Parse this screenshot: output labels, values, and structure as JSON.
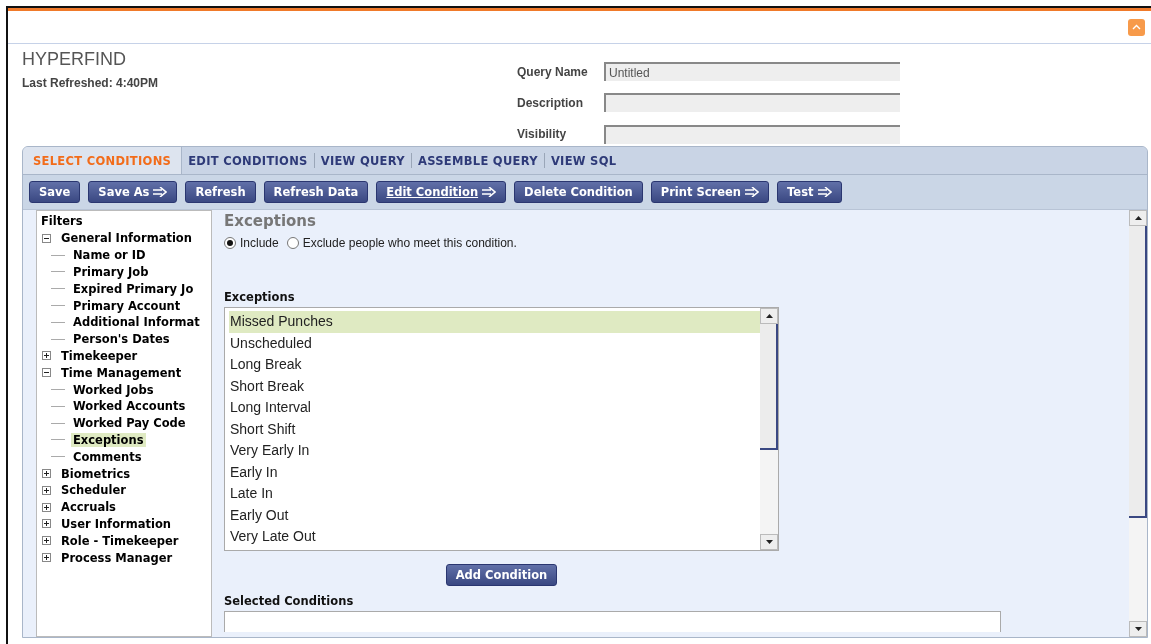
{
  "header": {
    "title": "HYPERFIND",
    "last_refreshed": "Last Refreshed: 4:40PM"
  },
  "query_form": [
    {
      "label": "Query Name",
      "value": "Untitled"
    },
    {
      "label": "Description"
    },
    {
      "label": "Visibility"
    }
  ],
  "tabs": [
    {
      "label": "SELECT CONDITIONS",
      "selected": true
    },
    {
      "label": "EDIT CONDITIONS",
      "selected": false
    },
    {
      "label": "VIEW QUERY",
      "selected": false
    },
    {
      "label": "ASSEMBLE QUERY",
      "selected": false
    },
    {
      "label": "VIEW SQL",
      "selected": false
    }
  ],
  "toolbar": [
    {
      "label": "Save",
      "arrow": false,
      "underlined": false
    },
    {
      "label": "Save As",
      "arrow": true,
      "underlined": false
    },
    {
      "label": "Refresh",
      "arrow": false,
      "underlined": false
    },
    {
      "label": "Refresh Data",
      "arrow": false,
      "underlined": false
    },
    {
      "label": "Edit Condition",
      "arrow": true,
      "underlined": true
    },
    {
      "label": "Delete Condition",
      "arrow": false,
      "underlined": false
    },
    {
      "label": "Print Screen",
      "arrow": true,
      "underlined": false
    },
    {
      "label": "Test",
      "arrow": true,
      "underlined": false
    }
  ],
  "filters": {
    "title": "Filters",
    "items": [
      {
        "label": "General Information",
        "expanded": true,
        "children": [
          {
            "label": "Name or ID",
            "selected": false
          },
          {
            "label": "Primary Job",
            "selected": false
          },
          {
            "label": "Expired Primary Jo",
            "selected": false
          },
          {
            "label": "Primary Account",
            "selected": false
          },
          {
            "label": "Additional Informat",
            "selected": false
          },
          {
            "label": "Person's Dates",
            "selected": false
          }
        ]
      },
      {
        "label": "Timekeeper",
        "expanded": false
      },
      {
        "label": "Time Management",
        "expanded": true,
        "children": [
          {
            "label": "Worked Jobs",
            "selected": false
          },
          {
            "label": "Worked Accounts",
            "selected": false
          },
          {
            "label": "Worked Pay Code",
            "selected": false
          },
          {
            "label": "Exceptions",
            "selected": true
          },
          {
            "label": "Comments",
            "selected": false
          }
        ]
      },
      {
        "label": "Biometrics",
        "expanded": false
      },
      {
        "label": "Scheduler",
        "expanded": false
      },
      {
        "label": "Accruals",
        "expanded": false
      },
      {
        "label": "User Information",
        "expanded": false
      },
      {
        "label": "Role - Timekeeper",
        "expanded": false
      },
      {
        "label": "Process Manager",
        "expanded": false
      }
    ]
  },
  "condition": {
    "title": "Exceptions",
    "options": [
      {
        "label": "Include",
        "selected": true
      },
      {
        "label": "Exclude people who meet this condition.",
        "selected": false
      }
    ],
    "list_label": "Exceptions",
    "list": [
      {
        "label": "Missed Punches",
        "selected": true
      },
      {
        "label": "Unscheduled",
        "selected": false
      },
      {
        "label": "Long Break",
        "selected": false
      },
      {
        "label": "Short Break",
        "selected": false
      },
      {
        "label": "Long Interval",
        "selected": false
      },
      {
        "label": "Short Shift",
        "selected": false
      },
      {
        "label": "Very Early In",
        "selected": false
      },
      {
        "label": "Early In",
        "selected": false
      },
      {
        "label": "Late In",
        "selected": false
      },
      {
        "label": "Early Out",
        "selected": false
      },
      {
        "label": "Very Late Out",
        "selected": false
      }
    ],
    "add_button": "Add Condition",
    "selected_label": "Selected Conditions"
  }
}
